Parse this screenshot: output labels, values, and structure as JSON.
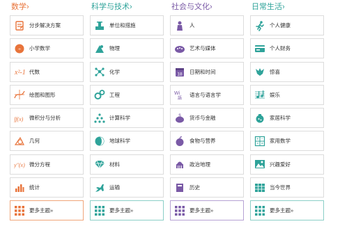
{
  "colors": {
    "math": "#e8743b",
    "science": "#2fa39a",
    "society": "#7a5aa6",
    "life": "#2fa39a"
  },
  "columns": [
    {
      "title": "数学›",
      "items": [
        {
          "label": "分步解决方案",
          "icon": "notepad-icon"
        },
        {
          "label": "小学数学",
          "icon": "calculator-icon"
        },
        {
          "label": "代数",
          "icon": "algebra-icon"
        },
        {
          "label": "绘图和图形",
          "icon": "graph-icon"
        },
        {
          "label": "微积分与分析",
          "icon": "integral-icon"
        },
        {
          "label": "几何",
          "icon": "geometry-icon"
        },
        {
          "label": "微分方程",
          "icon": "derivative-icon"
        },
        {
          "label": "统计",
          "icon": "bar-chart-icon"
        }
      ],
      "more": "更多主题»"
    },
    {
      "title": "科学与技术›",
      "items": [
        {
          "label": "单位和措施",
          "icon": "scale-icon"
        },
        {
          "label": "物理",
          "icon": "physics-icon"
        },
        {
          "label": "化学",
          "icon": "molecule-icon"
        },
        {
          "label": "工程",
          "icon": "gears-icon"
        },
        {
          "label": "计算科学",
          "icon": "triangle-dots-icon"
        },
        {
          "label": "地球科学",
          "icon": "earth-icon"
        },
        {
          "label": "材料",
          "icon": "diamond-icon"
        },
        {
          "label": "运输",
          "icon": "transport-icon"
        }
      ],
      "more": "更多主题»"
    },
    {
      "title": "社会与文化›",
      "items": [
        {
          "label": "人",
          "icon": "person-icon"
        },
        {
          "label": "艺术与媒体",
          "icon": "palette-icon"
        },
        {
          "label": "日期和时间",
          "icon": "calendar-icon"
        },
        {
          "label": "语言与语言学",
          "icon": "language-icon"
        },
        {
          "label": "货币与金融",
          "icon": "piggy-bank-icon"
        },
        {
          "label": "食物与营养",
          "icon": "apple-icon"
        },
        {
          "label": "政治地理",
          "icon": "capitol-icon"
        },
        {
          "label": "历史",
          "icon": "book-icon"
        }
      ],
      "more": "更多主题»"
    },
    {
      "title": "日常生活›",
      "items": [
        {
          "label": "个人健康",
          "icon": "runner-icon"
        },
        {
          "label": "个人财务",
          "icon": "card-icon"
        },
        {
          "label": "惊喜",
          "icon": "bird-icon"
        },
        {
          "label": "娱乐",
          "icon": "music-icon"
        },
        {
          "label": "家居科学",
          "icon": "home-science-icon"
        },
        {
          "label": "家用数学",
          "icon": "house-math-icon"
        },
        {
          "label": "兴趣爱好",
          "icon": "picture-icon"
        },
        {
          "label": "当今世界",
          "icon": "world-icon"
        }
      ],
      "more": "更多主题»"
    }
  ]
}
